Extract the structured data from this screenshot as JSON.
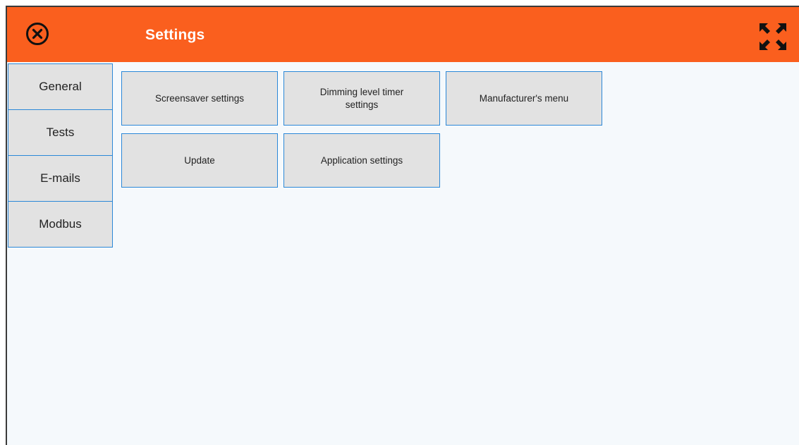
{
  "header": {
    "title": "Settings",
    "close_icon": "close-circle-icon",
    "expand_icon": "fullscreen-expand-icon",
    "background_color": "#fa5f1e"
  },
  "tabs": [
    {
      "label": "General"
    },
    {
      "label": "Tests"
    },
    {
      "label": "E-mails"
    },
    {
      "label": "Modbus"
    }
  ],
  "tiles": [
    {
      "label": "Screensaver settings"
    },
    {
      "label": "Dimming level timer\nsettings"
    },
    {
      "label": "Manufacturer's menu"
    },
    {
      "label": "Update"
    },
    {
      "label": "Application settings"
    }
  ],
  "colors": {
    "accent_border": "#2b88d8",
    "tile_background": "#e2e2e2",
    "content_background": "#f5f9fc"
  }
}
